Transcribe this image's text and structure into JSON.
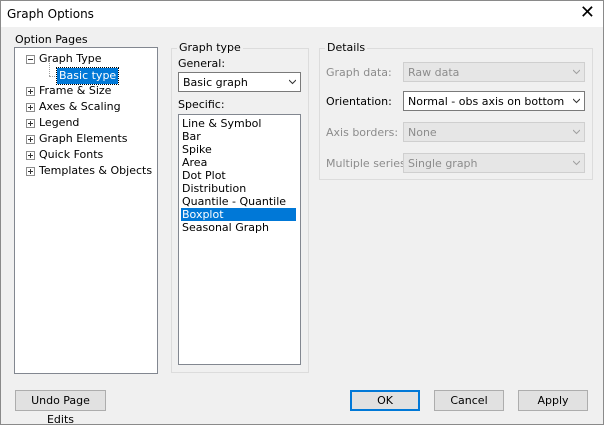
{
  "window": {
    "title": "Graph Options"
  },
  "option_pages": {
    "label": "Option Pages",
    "tree": [
      {
        "label": "Graph Type",
        "expanded": true
      },
      {
        "label": "Basic type",
        "child": true,
        "selected": true
      },
      {
        "label": "Frame & Size"
      },
      {
        "label": "Axes & Scaling"
      },
      {
        "label": "Legend"
      },
      {
        "label": "Graph Elements"
      },
      {
        "label": "Quick Fonts"
      },
      {
        "label": "Templates & Objects"
      }
    ]
  },
  "graph_type": {
    "group_label": "Graph type",
    "general_label": "General:",
    "general_value": "Basic graph",
    "specific_label": "Specific:",
    "specific_items": [
      "Line & Symbol",
      "Bar",
      "Spike",
      "Area",
      "Dot Plot",
      "Distribution",
      "Quantile - Quantile",
      "Boxplot",
      "Seasonal Graph"
    ],
    "specific_selected": "Boxplot"
  },
  "details": {
    "group_label": "Details",
    "graph_data_label": "Graph data:",
    "graph_data_value": "Raw data",
    "orientation_label": "Orientation:",
    "orientation_value": "Normal - obs axis on bottom",
    "axis_borders_label": "Axis borders:",
    "axis_borders_value": "None",
    "multiple_series_label": "Multiple series:",
    "multiple_series_value": "Single graph"
  },
  "buttons": {
    "undo": "Undo Page Edits",
    "ok": "OK",
    "cancel": "Cancel",
    "apply": "Apply"
  },
  "colors": {
    "selection": "#0078d7",
    "dialog_bg": "#f0f0f0"
  }
}
